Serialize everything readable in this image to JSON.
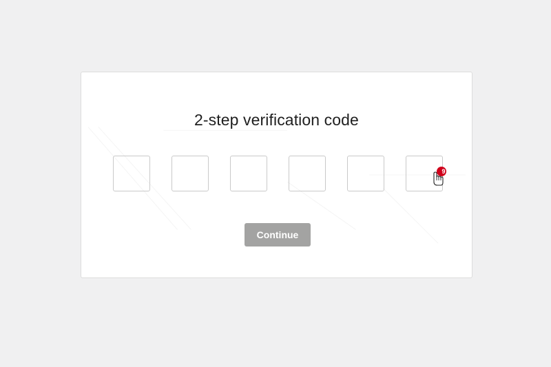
{
  "dialog": {
    "title": "2-step verification code",
    "code_inputs": [
      {
        "value": "",
        "placeholder": ""
      },
      {
        "value": "",
        "placeholder": ""
      },
      {
        "value": "",
        "placeholder": ""
      },
      {
        "value": "",
        "placeholder": ""
      },
      {
        "value": "",
        "placeholder": ""
      },
      {
        "value": "",
        "placeholder": ""
      }
    ],
    "continue_label": "Continue"
  },
  "cursor": {
    "icon": "hand-pointer-icon",
    "badge_text": "9"
  },
  "colors": {
    "page_background": "#f0f0f1",
    "card_background": "#ffffff",
    "button_disabled": "#a3a3a2",
    "cursor_badge": "#d0021b"
  }
}
